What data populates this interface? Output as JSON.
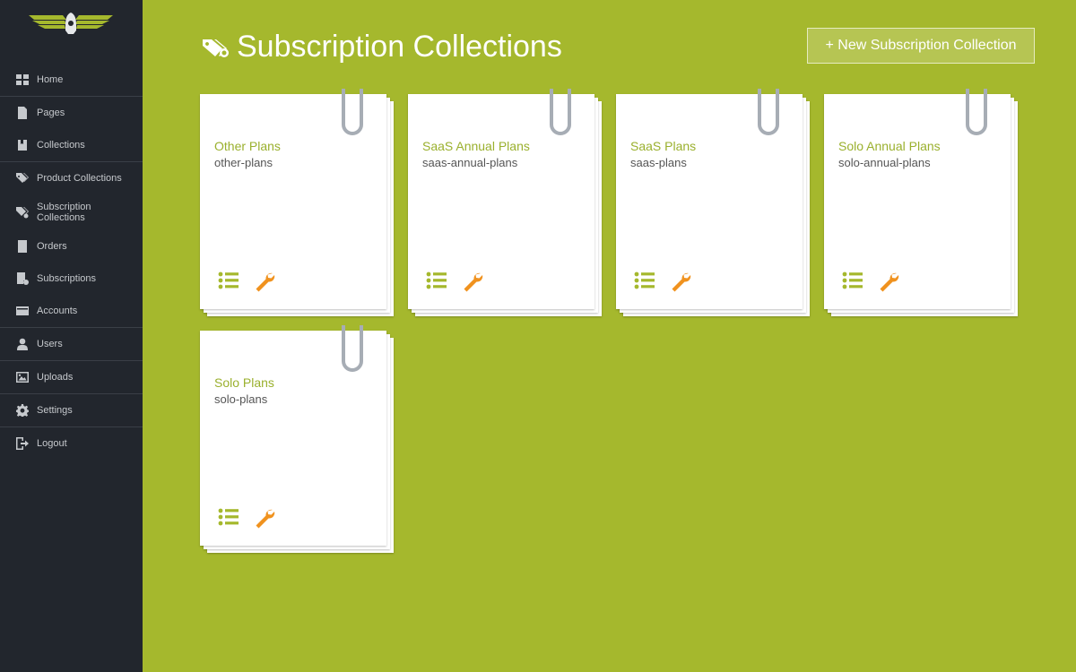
{
  "page": {
    "title": "Subscription Collections",
    "new_button_label": "+ New Subscription Collection"
  },
  "sidebar": {
    "items": [
      {
        "label": "Home",
        "icon": "home-icon"
      },
      {
        "label": "Pages",
        "icon": "page-icon"
      },
      {
        "label": "Collections",
        "icon": "collections-icon"
      },
      {
        "label": "Product Collections",
        "icon": "tags-icon"
      },
      {
        "label": "Subscription Collections",
        "icon": "subscription-tags-icon"
      },
      {
        "label": "Orders",
        "icon": "orders-icon"
      },
      {
        "label": "Subscriptions",
        "icon": "subscriptions-icon"
      },
      {
        "label": "Accounts",
        "icon": "credit-card-icon"
      },
      {
        "label": "Users",
        "icon": "user-icon"
      },
      {
        "label": "Uploads",
        "icon": "image-icon"
      },
      {
        "label": "Settings",
        "icon": "gear-icon"
      },
      {
        "label": "Logout",
        "icon": "logout-icon"
      }
    ]
  },
  "cards": [
    {
      "title": "Other Plans",
      "slug": "other-plans"
    },
    {
      "title": "SaaS Annual Plans",
      "slug": "saas-annual-plans"
    },
    {
      "title": "SaaS Plans",
      "slug": "saas-plans"
    },
    {
      "title": "Solo Annual Plans",
      "slug": "solo-annual-plans"
    },
    {
      "title": "Solo Plans",
      "slug": "solo-plans"
    }
  ],
  "colors": {
    "background": "#a5b82d",
    "sidebar": "#22262d",
    "card_title": "#9ab02d",
    "list_icon": "#a5b82d",
    "wrench_icon": "#f0921e",
    "clip": "#a7adb5"
  }
}
